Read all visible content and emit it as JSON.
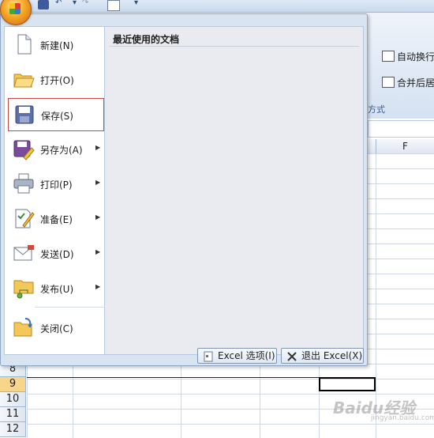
{
  "ribbon": {
    "wrap_text": "自动换行",
    "merge_center": "合并后居",
    "group_label": "方式"
  },
  "column_header_f": "F",
  "rows": [
    {
      "num": "8",
      "selected": false
    },
    {
      "num": "9",
      "selected": true
    },
    {
      "num": "10",
      "selected": false
    },
    {
      "num": "11",
      "selected": false
    },
    {
      "num": "12",
      "selected": false
    }
  ],
  "menu": {
    "recent_title": "最近使用的文档",
    "items": [
      {
        "label": "新建(N)",
        "submenu": false,
        "highlighted": false,
        "icon": "new-document-icon"
      },
      {
        "label": "打开(O)",
        "submenu": false,
        "highlighted": false,
        "icon": "open-folder-icon"
      },
      {
        "label": "保存(S)",
        "submenu": false,
        "highlighted": true,
        "icon": "save-disk-icon"
      },
      {
        "label": "另存为(A)",
        "submenu": true,
        "highlighted": false,
        "icon": "save-as-icon"
      },
      {
        "label": "打印(P)",
        "submenu": true,
        "highlighted": false,
        "icon": "printer-icon"
      },
      {
        "label": "准备(E)",
        "submenu": true,
        "highlighted": false,
        "icon": "prepare-icon"
      },
      {
        "label": "发送(D)",
        "submenu": true,
        "highlighted": false,
        "icon": "send-mail-icon"
      },
      {
        "label": "发布(U)",
        "submenu": true,
        "highlighted": false,
        "icon": "publish-icon"
      },
      {
        "label": "关闭(C)",
        "submenu": false,
        "highlighted": false,
        "icon": "close-folder-icon"
      }
    ],
    "options_button": "Excel 选项(I)",
    "exit_button": "退出 Excel(X)"
  },
  "watermark": "Baidu经验",
  "watermark_sub": "jingyan.baidu.com"
}
